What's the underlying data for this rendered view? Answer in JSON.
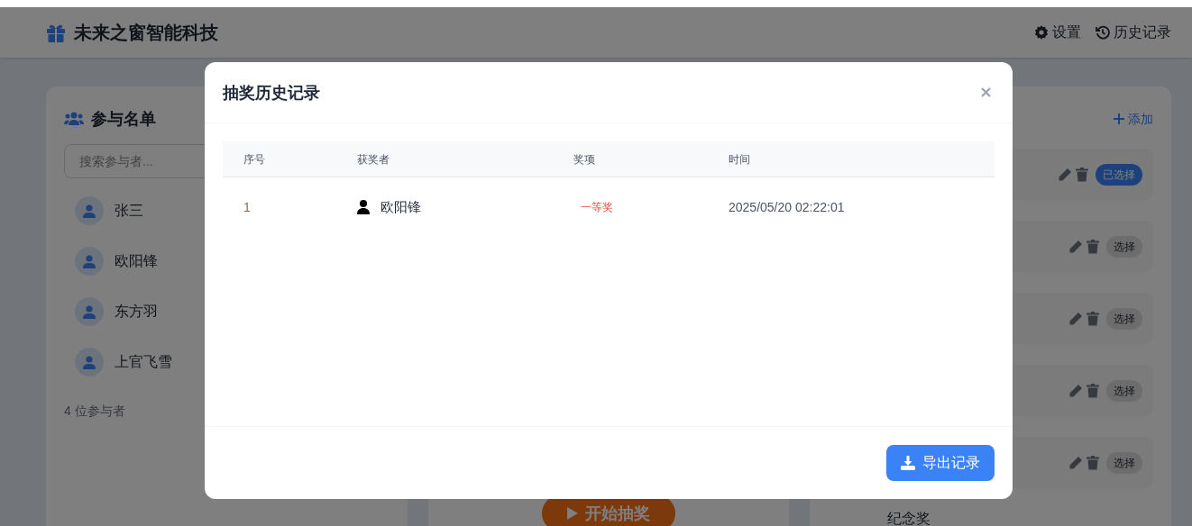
{
  "header": {
    "title": "未来之窗智能科技",
    "nav": [
      {
        "kind": "settings",
        "label": "设置"
      },
      {
        "kind": "history",
        "label": "历史记录"
      }
    ]
  },
  "participants": {
    "title": "参与名单",
    "search_placeholder": "搜索参与者...",
    "people": [
      {
        "name": "张三"
      },
      {
        "name": "欧阳锋"
      },
      {
        "name": "东方羽"
      },
      {
        "name": "上官飞雪"
      }
    ],
    "count": "4 位参与者"
  },
  "prizes": {
    "add_label": "添加",
    "items": [
      {
        "select_label": "已选择",
        "selected": true
      },
      {
        "select_label": "选择",
        "selected": false
      },
      {
        "select_label": "选择",
        "selected": false
      },
      {
        "select_label": "选择",
        "selected": false
      },
      {
        "select_label": "选择",
        "selected": false
      }
    ],
    "footer_text": "纪念奖"
  },
  "start_button": "开始抽奖",
  "modal": {
    "title": "抽奖历史记录",
    "columns": [
      "序号",
      "获奖者",
      "奖项",
      "时间"
    ],
    "rows": [
      {
        "index": "1",
        "winner": "欧阳锋",
        "prize": "一等奖",
        "time": "2025/05/20 02:22:01"
      }
    ],
    "export_button": "导出记录"
  }
}
